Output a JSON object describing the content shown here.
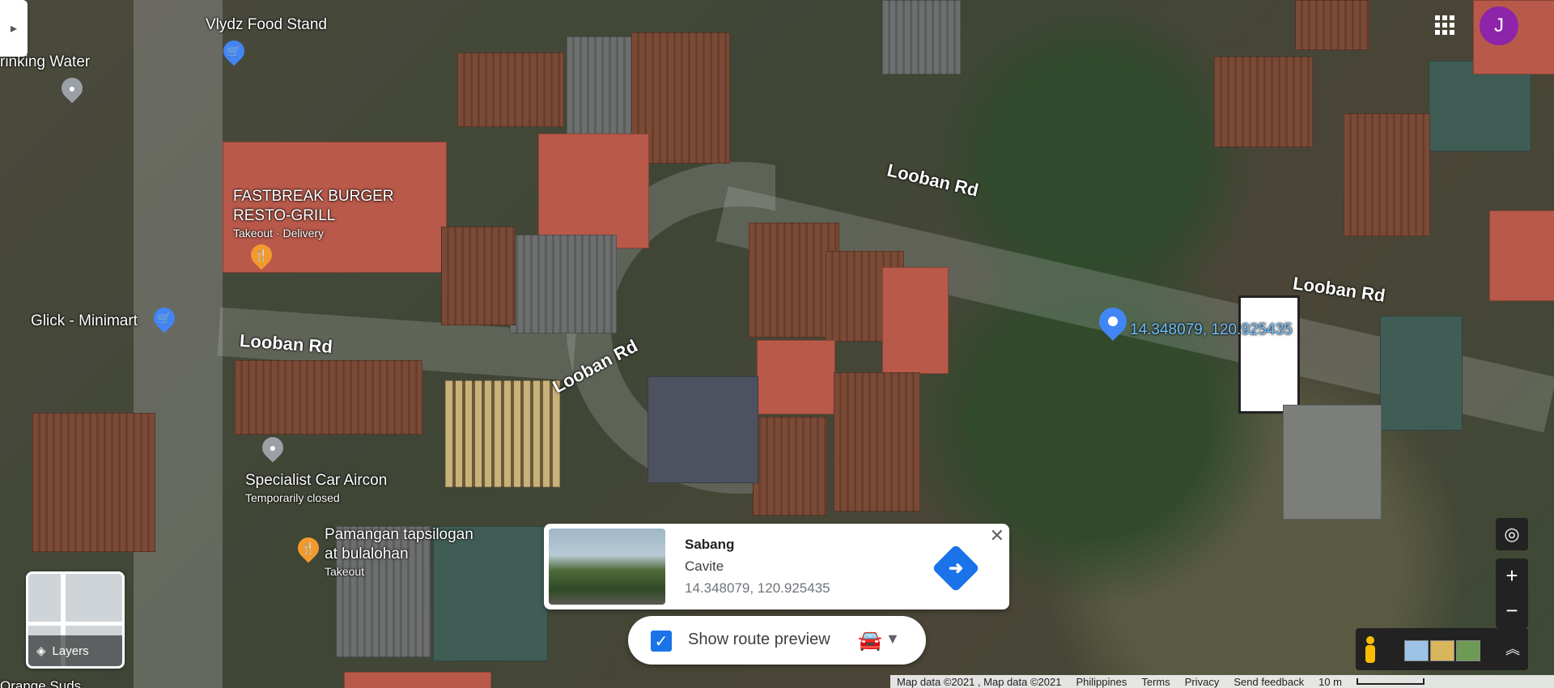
{
  "map": {
    "road_names": [
      "Looban Rd",
      "Looban Rd",
      "Looban Rd",
      "Looban Rd"
    ],
    "pois": [
      {
        "name": "Vlydz Food Stand",
        "category": "shopping-cart-icon",
        "color": "#4285f4"
      },
      {
        "name": "rinking Water",
        "category": "pin-icon",
        "color": "#9aa0a6"
      },
      {
        "name": "FASTBREAK BURGER",
        "name2": "RESTO-GRILL",
        "sub": "Takeout · Delivery",
        "category": "fork-knife-icon",
        "color": "#f29a2e"
      },
      {
        "name": "Glick - Minimart",
        "category": "shopping-cart-icon",
        "color": "#4285f4"
      },
      {
        "name": "Specialist Car Aircon",
        "sub": "Temporarily closed",
        "category": "pin-icon",
        "color": "#9aa0a6"
      },
      {
        "name": "Pamangan tapsilogan",
        "name2": "at bulalohan",
        "sub": "Takeout",
        "category": "fork-knife-icon",
        "color": "#f29a2e"
      },
      {
        "name": "Orange Suds",
        "category": "pin-icon",
        "color": "#4285f4"
      }
    ],
    "dropped_pin": {
      "label": "14.348079, 120.925435",
      "color": "#4285f4"
    }
  },
  "account": {
    "initial": "J",
    "color": "#8e24aa"
  },
  "layers": {
    "label": "Layers"
  },
  "card": {
    "title": "Sabang",
    "subtitle": "Cavite",
    "coordinates": "14.348079, 120.925435",
    "close": "✕",
    "directions_icon": "directions-icon"
  },
  "route_preview": {
    "label": "Show route preview",
    "checked": true,
    "mode_icon": "car-icon"
  },
  "controls": {
    "locate": "◎",
    "zoom_in": "+",
    "zoom_out": "−"
  },
  "footer": {
    "attribution": "Map data ©2021 , Map data ©2021",
    "region": "Philippines",
    "terms": "Terms",
    "privacy": "Privacy",
    "feedback": "Send feedback",
    "scale": "10 m"
  }
}
